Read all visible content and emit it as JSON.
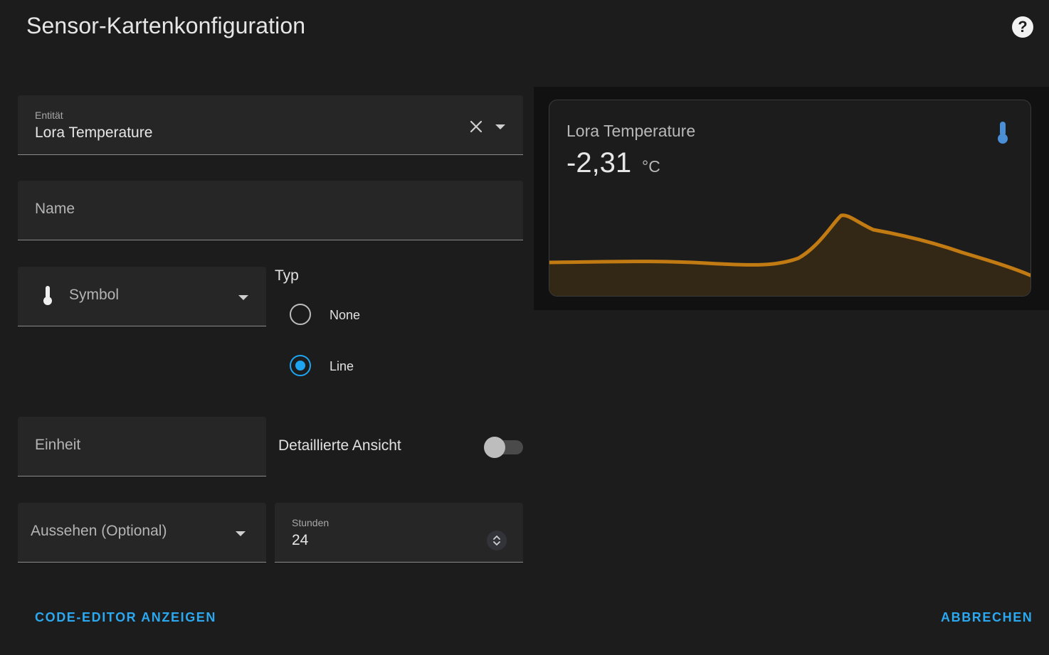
{
  "dialog": {
    "title": "Sensor-Kartenkonfiguration",
    "help_icon": "help-circle-icon"
  },
  "form": {
    "entity": {
      "label": "Entität",
      "value": "Lora Temperature"
    },
    "name": {
      "placeholder": "Name"
    },
    "icon": {
      "placeholder": "Symbol",
      "icon": "thermometer-icon"
    },
    "type": {
      "label": "Typ",
      "options": [
        "None",
        "Line"
      ],
      "selected": "Line"
    },
    "unit": {
      "placeholder": "Einheit"
    },
    "detailed_view": {
      "label": "Detaillierte Ansicht",
      "on": false
    },
    "appearance": {
      "placeholder": "Aussehen (Optional)"
    },
    "hours": {
      "label": "Stunden",
      "value": "24"
    }
  },
  "buttons": {
    "code_editor": "CODE-EDITOR ANZEIGEN",
    "cancel": "ABBRECHEN"
  },
  "preview": {
    "name": "Lora Temperature",
    "value": "-2,31",
    "unit": "°C",
    "icon": "thermometer-icon",
    "graph_color": "#c27a13"
  },
  "colors": {
    "accent": "#2ca8f0",
    "background": "#1c1c1c",
    "field": "#262626"
  }
}
